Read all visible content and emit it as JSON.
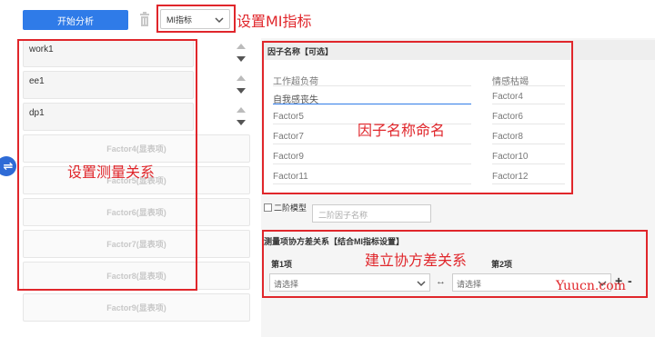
{
  "toolbar": {
    "run_label": "开始分析",
    "model_select": "MI指标"
  },
  "annotations": {
    "set_mi": "设置MI指标",
    "set_measurement": "设置测量关系",
    "name_factors": "因子名称命名",
    "build_covariance": "建立协方差关系"
  },
  "variables": [
    "work1",
    "ee1",
    "dp1"
  ],
  "factor_slots": [
    "Factor4(显表项)",
    "Factor5(显表项)",
    "Factor6(显表项)",
    "Factor7(显表项)",
    "Factor8(显表项)",
    "Factor9(显表项)"
  ],
  "factor_names": {
    "header": "因子名称【可选】",
    "left": [
      "工作超负荷",
      "自我感丧失",
      "Factor5",
      "Factor7",
      "Factor9",
      "Factor11"
    ],
    "right": [
      "情感枯竭",
      "Factor4",
      "Factor6",
      "Factor8",
      "Factor10",
      "Factor12"
    ]
  },
  "second_order": {
    "label": "二阶模型",
    "placeholder": "二阶因子名称"
  },
  "covariance": {
    "header": "测量项协方差关系【结合MI指标设置】",
    "item1_label": "第1项",
    "item2_label": "第2项",
    "select1_placeholder": "请选择",
    "select2_placeholder": "请选择",
    "link_symbol": "↔",
    "add": "+",
    "remove": "-"
  },
  "watermark": "Yuucn.com",
  "colors": {
    "primary": "#2f7be8",
    "annotation": "#e0262b"
  }
}
